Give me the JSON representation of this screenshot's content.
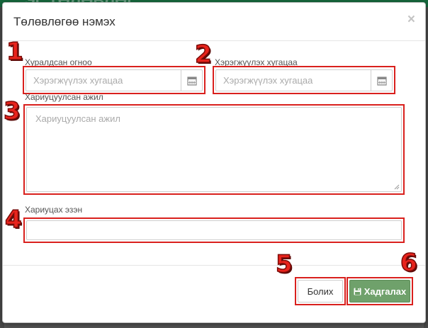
{
  "background": {
    "header_color": "#16683d",
    "header_text": "ЭГ ТӨЛӨВЛӨГ"
  },
  "modal": {
    "title": "Төлөвлөгөө нэмэх",
    "close_glyph": "×"
  },
  "form": {
    "meeting_date": {
      "label": "Хуралдсан огноо",
      "placeholder": "Хэрэгжүүлэх хугацаа",
      "icon": "calendar-icon"
    },
    "deadline": {
      "label": "Хэрэгжүүлэх хугацаа",
      "placeholder": "Хэрэгжүүлэх хугацаа",
      "icon": "calendar-icon"
    },
    "responsible_work": {
      "label": "Хариуцуулсан ажил",
      "placeholder": "Хариуцуулсан ажил"
    },
    "owner": {
      "label": "Хариуцах эзэн",
      "value": ""
    }
  },
  "buttons": {
    "cancel_label": "Болих",
    "save_label": "Хадгалах",
    "save_icon": "floppy-disk-icon"
  },
  "annotations": {
    "markers": [
      "1",
      "2",
      "3",
      "4",
      "5",
      "6"
    ],
    "color": "#d9201d"
  }
}
